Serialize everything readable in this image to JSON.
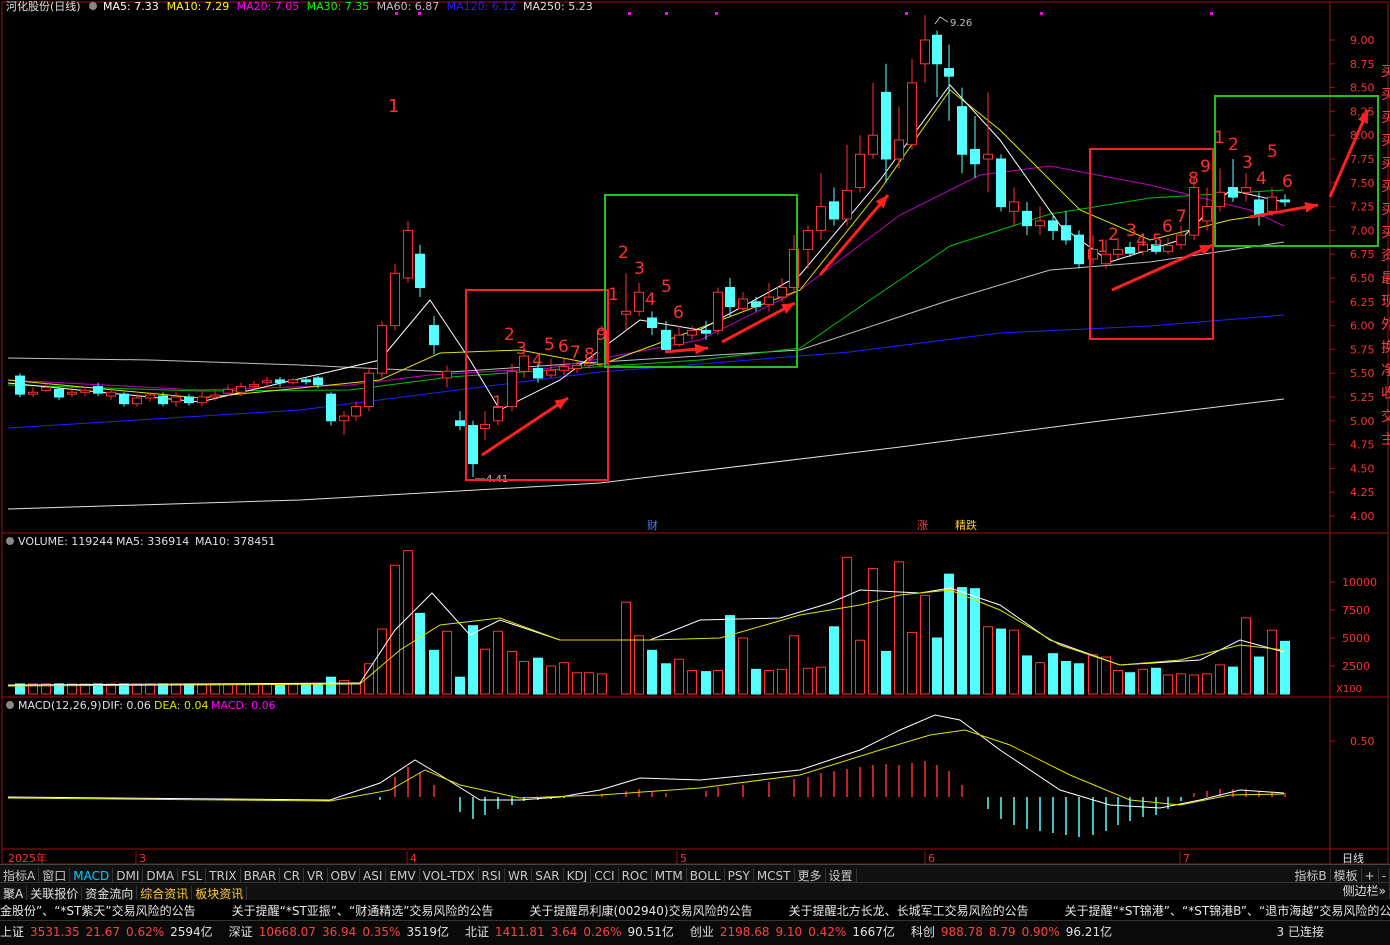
{
  "header": {
    "title": "河化股份(日线)",
    "ma_items": [
      {
        "label": "MA5: 7.33",
        "color": "#ffffff"
      },
      {
        "label": "MA10: 7.29",
        "color": "#ffff00"
      },
      {
        "label": "MA20: 7.05",
        "color": "#ff00ff"
      },
      {
        "label": "MA30: 7.35",
        "color": "#00ff00"
      },
      {
        "label": "MA60: 6.87",
        "color": "#c0c0c0"
      },
      {
        "label": "MA120: 6.12",
        "color": "#2020ff"
      },
      {
        "label": "MA250: 5.23",
        "color": "#e0e0e0"
      }
    ]
  },
  "price_axis": {
    "labels": [
      "9.00",
      "8.75",
      "8.50",
      "8.25",
      "8.00",
      "7.75",
      "7.50",
      "7.25",
      "7.00",
      "6.75",
      "6.50",
      "6.25",
      "6.00",
      "5.75",
      "5.50",
      "5.25",
      "5.00",
      "4.75",
      "4.50",
      "4.25",
      "4.00"
    ]
  },
  "price_marks": {
    "high": "9.26",
    "low": "4.41"
  },
  "events": [
    {
      "text": "财",
      "color": "#4080ff"
    },
    {
      "text": "涨",
      "color": "#ff4040"
    },
    {
      "text": "精跌",
      "color": "#ffcc33"
    }
  ],
  "annotations": {
    "big_one": "1",
    "box1_nums": [
      "1",
      "2",
      "3",
      "4",
      "5",
      "6",
      "7",
      "8",
      "9"
    ],
    "box2_nums": [
      "1",
      "2",
      "3",
      "4",
      "5",
      "6"
    ],
    "box3_nums": [
      "1",
      "2",
      "3",
      "4",
      "5",
      "6",
      "7",
      "8",
      "9"
    ],
    "box4_nums": [
      "1",
      "2",
      "3",
      "4",
      "5",
      "6"
    ]
  },
  "side_text": "买买买买买买买买资最现外换净收交主",
  "volume": {
    "label": "VOLUME: 119244",
    "ma5": "MA5: 336914",
    "ma10": "MA10: 378451",
    "axis": [
      "10000",
      "7500",
      "5000",
      "2500"
    ],
    "unit": "X100"
  },
  "macd": {
    "label": "MACD(12,26,9)",
    "dif": "DIF: 0.06",
    "dea": "DEA: 0.04",
    "macd": "MACD: 0.06",
    "axis": [
      "0.50"
    ]
  },
  "date_axis": {
    "year": "2025年",
    "months": [
      "3",
      "4",
      "5",
      "6",
      "7"
    ],
    "right": "日线"
  },
  "colors": {
    "up": "#ff3030",
    "down": "#54ffff",
    "red_box": "#ff2020",
    "green_box": "#20c020",
    "arrow": "#ff2020"
  },
  "indicator_tabs": [
    "指标A",
    "窗口",
    "MACD",
    "DMI",
    "DMA",
    "FSL",
    "TRIX",
    "BRAR",
    "CR",
    "VR",
    "OBV",
    "ASI",
    "EMV",
    "VOL-TDX",
    "RSI",
    "WR",
    "SAR",
    "KDJ",
    "CCI",
    "ROC",
    "MTM",
    "BOLL",
    "PSY",
    "MCST",
    "更多",
    "设置"
  ],
  "indicator_active": "MACD",
  "indicator_right": [
    "指标B",
    "模板",
    "+",
    "-"
  ],
  "info_tabs": [
    "聚A",
    "关联报价",
    "资金流向",
    "综合资讯",
    "板块资讯"
  ],
  "info_right": "侧边栏»",
  "news": [
    "金股份”、“*ST紫天”交易风险的公告",
    "关于提醒“*ST亚振”、“财通精选”交易风险的公告",
    "关于提醒昂利康(002940)交易风险的公告",
    "关于提醒北方长龙、长城军工交易风险的公告",
    "关于提醒“*ST锦港”、“*ST锦港B”、“退市海越”交易风险的公"
  ],
  "status": [
    {
      "name": "上证",
      "price": "3531.35",
      "chg": "21.67",
      "pct": "0.62%",
      "amt": "2594亿"
    },
    {
      "name": "深证",
      "price": "10668.07",
      "chg": "36.94",
      "pct": "0.35%",
      "amt": "3519亿"
    },
    {
      "name": "北证",
      "price": "1411.81",
      "chg": "3.64",
      "pct": "0.26%",
      "amt": "90.51亿"
    },
    {
      "name": "创业",
      "price": "2198.68",
      "chg": "9.10",
      "pct": "0.42%",
      "amt": "1667亿"
    },
    {
      "name": "科创",
      "price": "988.78",
      "chg": "8.79",
      "pct": "0.90%",
      "amt": "96.21亿"
    }
  ],
  "connection": "3 已连接"
}
